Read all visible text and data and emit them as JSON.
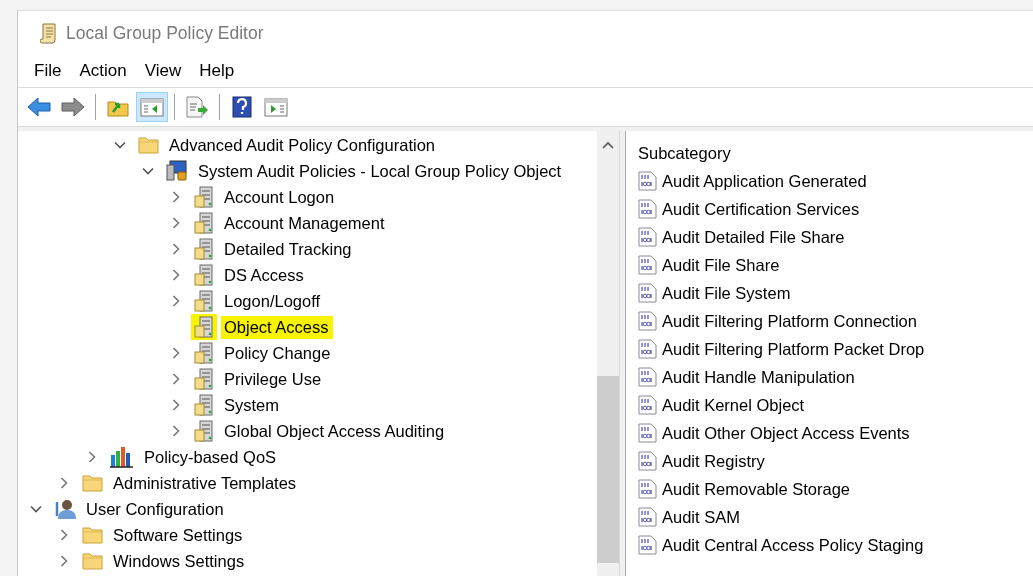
{
  "window": {
    "title": "Local Group Policy Editor"
  },
  "menu": [
    {
      "label": "File"
    },
    {
      "label": "Action"
    },
    {
      "label": "View"
    },
    {
      "label": "Help"
    }
  ],
  "toolbar": [
    {
      "kind": "back",
      "pressed": false,
      "disabled": false
    },
    {
      "kind": "forward",
      "pressed": false,
      "disabled": true
    },
    {
      "kind": "separator"
    },
    {
      "kind": "up",
      "pressed": false,
      "disabled": false
    },
    {
      "kind": "tree-toggle",
      "pressed": true,
      "disabled": false
    },
    {
      "kind": "separator"
    },
    {
      "kind": "export",
      "pressed": false,
      "disabled": false
    },
    {
      "kind": "separator"
    },
    {
      "kind": "help",
      "pressed": false,
      "disabled": false
    },
    {
      "kind": "action-pane",
      "pressed": false,
      "disabled": false
    }
  ],
  "tree": {
    "items": [
      {
        "children": [
          {
            "children": [
              {
                "children": [
                  {
                    "label": "Advanced Audit Policy Configuration",
                    "kind": "folder",
                    "expanded": true,
                    "selected": false,
                    "children": [
                      {
                        "label": "System Audit Policies - Local Group Policy Object",
                        "kind": "policy-object",
                        "expanded": true,
                        "selected": false,
                        "children": [
                          {
                            "label": "Account Logon",
                            "kind": "category",
                            "expanded": false,
                            "selected": false
                          },
                          {
                            "label": "Account Management",
                            "kind": "category",
                            "expanded": false,
                            "selected": false
                          },
                          {
                            "label": "Detailed Tracking",
                            "kind": "category",
                            "expanded": false,
                            "selected": false
                          },
                          {
                            "label": "DS Access",
                            "kind": "category",
                            "expanded": false,
                            "selected": false
                          },
                          {
                            "label": "Logon/Logoff",
                            "kind": "category",
                            "expanded": false,
                            "selected": false
                          },
                          {
                            "label": "Object Access",
                            "kind": "category",
                            "selected": true
                          },
                          {
                            "label": "Policy Change",
                            "kind": "category",
                            "expanded": false,
                            "selected": false
                          },
                          {
                            "label": "Privilege Use",
                            "kind": "category",
                            "expanded": false,
                            "selected": false
                          },
                          {
                            "label": "System",
                            "kind": "category",
                            "expanded": false,
                            "selected": false
                          },
                          {
                            "label": "Global Object Access Auditing",
                            "kind": "category",
                            "expanded": false,
                            "selected": false
                          }
                        ]
                      }
                    ]
                  }
                ]
              },
              {
                "label": "Policy-based QoS",
                "kind": "qos",
                "expanded": false,
                "selected": false
              }
            ]
          },
          {
            "label": "Administrative Templates",
            "kind": "folder",
            "expanded": false,
            "selected": false
          }
        ]
      },
      {
        "label": "User Configuration",
        "kind": "user",
        "expanded": true,
        "selected": false,
        "children": [
          {
            "label": "Software Settings",
            "kind": "folder",
            "expanded": false,
            "selected": false
          },
          {
            "label": "Windows Settings",
            "kind": "folder",
            "expanded": false,
            "selected": false
          }
        ]
      }
    ]
  },
  "list": {
    "columns": [
      "Subcategory"
    ],
    "rows": [
      "Audit Application Generated",
      "Audit Certification Services",
      "Audit Detailed File Share",
      "Audit File Share",
      "Audit File System",
      "Audit Filtering Platform Connection",
      "Audit Filtering Platform Packet Drop",
      "Audit Handle Manipulation",
      "Audit Kernel Object",
      "Audit Other Object Access Events",
      "Audit Registry",
      "Audit Removable Storage",
      "Audit SAM",
      "Audit Central Access Policy Staging"
    ]
  }
}
